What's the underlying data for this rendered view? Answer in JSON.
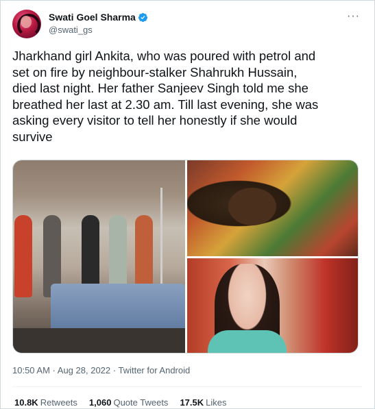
{
  "author": {
    "display_name": "Swati Goel Sharma",
    "handle": "@swati_gs"
  },
  "more_label": "···",
  "tweet_text": "Jharkhand girl Ankita, who was poured with petrol and\nset on fire by neighbour-stalker Shahrukh Hussain,\ndied last night. Her father Sanjeev Singh told me she\nbreathed her last at 2.30 am. Till last evening, she was\nasking every visitor to tell her honestly if she would\nsurvive",
  "meta": {
    "time": "10:50 AM",
    "separator1": " · ",
    "date": "Aug 28, 2022",
    "separator2": " · ",
    "source": "Twitter for Android"
  },
  "stats": {
    "retweets_count": "10.8K",
    "retweets_label": "Retweets",
    "quotes_count": "1,060",
    "quotes_label": "Quote Tweets",
    "likes_count": "17.5K",
    "likes_label": "Likes"
  },
  "colors": {
    "verified": "#1d9bf0",
    "secondary_text": "#536471",
    "primary_text": "#0f1419"
  }
}
